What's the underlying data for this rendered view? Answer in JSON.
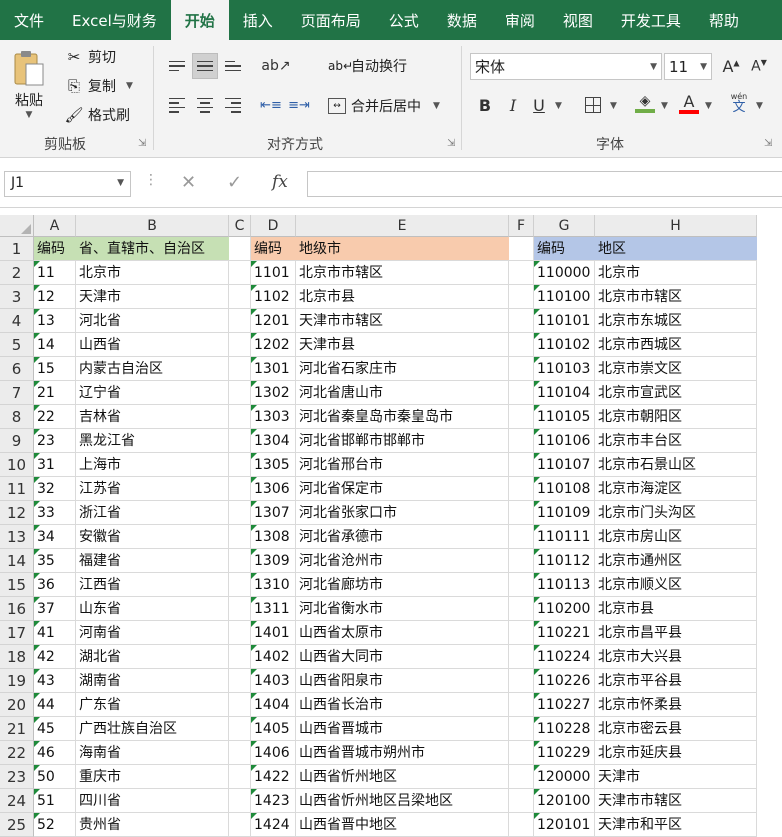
{
  "tabs": [
    "文件",
    "Excel与财务",
    "开始",
    "插入",
    "页面布局",
    "公式",
    "数据",
    "审阅",
    "视图",
    "开发工具",
    "帮助"
  ],
  "active_tab": "开始",
  "ribbon": {
    "clipboard": {
      "paste": "粘贴",
      "cut": "剪切",
      "copy": "复制",
      "format_painter": "格式刷",
      "group": "剪贴板"
    },
    "alignment": {
      "wrap_text": "自动换行",
      "merge_center": "合并后居中",
      "group": "对齐方式"
    },
    "font": {
      "font_name": "宋体",
      "font_size": "11",
      "bold": "B",
      "italic": "I",
      "underline": "U",
      "phonetic": "wén",
      "font_color": "#ff0000",
      "fill_color": "#70ad47",
      "group": "字体"
    }
  },
  "formula_bar": {
    "name_box": "J1",
    "fx": "fx",
    "value": ""
  },
  "sheet": {
    "columns": [
      {
        "name": "A"
      },
      {
        "name": "B"
      },
      {
        "name": "C"
      },
      {
        "name": "D"
      },
      {
        "name": "E"
      },
      {
        "name": "F"
      },
      {
        "name": "G"
      },
      {
        "name": "H"
      }
    ],
    "row_numbers": [
      "1",
      "2",
      "3",
      "4",
      "5",
      "6",
      "7",
      "8",
      "9",
      "10",
      "11",
      "12",
      "13",
      "14",
      "15",
      "16",
      "17",
      "18",
      "19",
      "20",
      "21",
      "22",
      "23",
      "24",
      "25"
    ],
    "header_colors": {
      "province": "#c6e0b4",
      "city": "#f8cbad",
      "district": "#b4c6e7"
    },
    "headers": {
      "A": "编码",
      "B": "省、直辖市、自治区",
      "D": "编码",
      "E": "地级市",
      "G": "编码",
      "H": "地区"
    },
    "rows": [
      [
        "11",
        "北京市",
        "1101",
        "北京市市辖区",
        "110000",
        "北京市"
      ],
      [
        "12",
        "天津市",
        "1102",
        "北京市县",
        "110100",
        "北京市市辖区"
      ],
      [
        "13",
        "河北省",
        "1201",
        "天津市市辖区",
        "110101",
        "北京市东城区"
      ],
      [
        "14",
        "山西省",
        "1202",
        "天津市县",
        "110102",
        "北京市西城区"
      ],
      [
        "15",
        "内蒙古自治区",
        "1301",
        "河北省石家庄市",
        "110103",
        "北京市崇文区"
      ],
      [
        "21",
        "辽宁省",
        "1302",
        "河北省唐山市",
        "110104",
        "北京市宣武区"
      ],
      [
        "22",
        "吉林省",
        "1303",
        "河北省秦皇岛市秦皇岛市",
        "110105",
        "北京市朝阳区"
      ],
      [
        "23",
        "黑龙江省",
        "1304",
        "河北省邯郸市邯郸市",
        "110106",
        "北京市丰台区"
      ],
      [
        "31",
        "上海市",
        "1305",
        "河北省邢台市",
        "110107",
        "北京市石景山区"
      ],
      [
        "32",
        "江苏省",
        "1306",
        "河北省保定市",
        "110108",
        "北京市海淀区"
      ],
      [
        "33",
        "浙江省",
        "1307",
        "河北省张家口市",
        "110109",
        "北京市门头沟区"
      ],
      [
        "34",
        "安徽省",
        "1308",
        "河北省承德市",
        "110111",
        "北京市房山区"
      ],
      [
        "35",
        "福建省",
        "1309",
        "河北省沧州市",
        "110112",
        "北京市通州区"
      ],
      [
        "36",
        "江西省",
        "1310",
        "河北省廊坊市",
        "110113",
        "北京市顺义区"
      ],
      [
        "37",
        "山东省",
        "1311",
        "河北省衡水市",
        "110200",
        "北京市县"
      ],
      [
        "41",
        "河南省",
        "1401",
        "山西省太原市",
        "110221",
        "北京市昌平县"
      ],
      [
        "42",
        "湖北省",
        "1402",
        "山西省大同市",
        "110224",
        "北京市大兴县"
      ],
      [
        "43",
        "湖南省",
        "1403",
        "山西省阳泉市",
        "110226",
        "北京市平谷县"
      ],
      [
        "44",
        "广东省",
        "1404",
        "山西省长治市",
        "110227",
        "北京市怀柔县"
      ],
      [
        "45",
        "广西壮族自治区",
        "1405",
        "山西省晋城市",
        "110228",
        "北京市密云县"
      ],
      [
        "46",
        "海南省",
        "1406",
        "山西省晋城市朔州市",
        "110229",
        "北京市延庆县"
      ],
      [
        "50",
        "重庆市",
        "1422",
        "山西省忻州地区",
        "120000",
        "天津市"
      ],
      [
        "51",
        "四川省",
        "1423",
        "山西省忻州地区吕梁地区",
        "120100",
        "天津市市辖区"
      ],
      [
        "52",
        "贵州省",
        "1424",
        "山西省晋中地区",
        "120101",
        "天津市和平区"
      ]
    ]
  }
}
